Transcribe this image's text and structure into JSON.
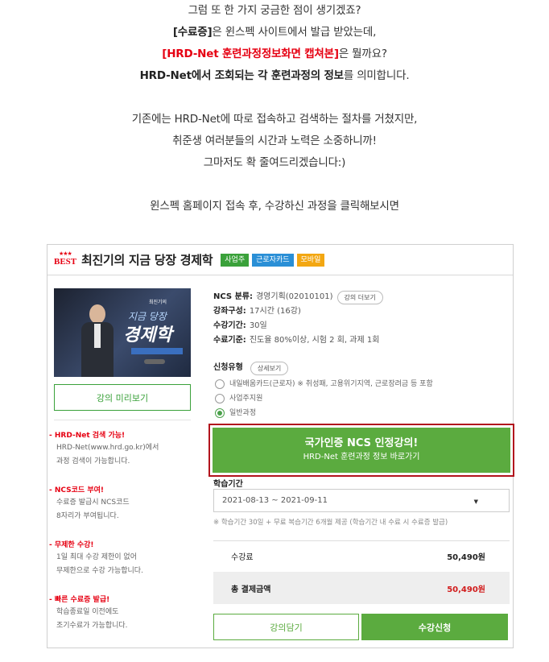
{
  "intro": {
    "line1": "그럼 또 한 가지 궁금한 점이 생기겠죠?",
    "line2_prefix": "[수료증]",
    "line2_suffix": "은 윈스펙 사이트에서 발급 받았는데,",
    "line3_highlight": "[HRD-Net 훈련과정정보화면 캡쳐본]",
    "line3_suffix": "은 뭘까요?",
    "line4_bold": "HRD-Net에서 조회되는 각 훈련과정의 정보",
    "line4_suffix": "를 의미합니다.",
    "line5": "기존에는 HRD-Net에 따로 접속하고 검색하는 절차를 거쳤지만,",
    "line6": "취준생 여러분들의 시간과 노력은 소중하니까!",
    "line7": "그마저도 확 줄여드리겠습니다:)",
    "line8": "윈스펙 홈페이지 접속 후, 수강하신 과정을 클릭해보시면"
  },
  "card": {
    "best_badge": "BEST",
    "title": "최진기의 지금 당장 경제학",
    "tags": [
      {
        "label": "사업주",
        "color": "#3aa13a"
      },
      {
        "label": "근로자카드",
        "color": "#2a8fd6"
      },
      {
        "label": "모바일",
        "color": "#f3a712"
      }
    ],
    "thumbnail": {
      "small_text": "지금 당장",
      "big_text": "경제학",
      "corner_text": "최진기의"
    },
    "preview_button": "강의 미리보기",
    "features": [
      {
        "title": "- HRD-Net 검색 가능!",
        "desc1": "HRD-Net(www.hrd.go.kr)에서",
        "desc2": "과정 검색이 가능합니다."
      },
      {
        "title": "- NCS코드 부여!",
        "desc1": "수료증 발급시 NCS코드",
        "desc2": "8자리가 부여됩니다."
      },
      {
        "title": "- 무제한 수강!",
        "desc1": "1일 최대 수강 제한이 없어",
        "desc2": "무제한으로 수강 가능합니다."
      },
      {
        "title": "- 빠른 수료증 발급!",
        "desc1": "학습종료일 이전에도",
        "desc2": "조기수료가 가능합니다."
      }
    ],
    "info": {
      "ncs_label": "NCS 분류:",
      "ncs_value": "경영기획(02010101)",
      "more_button": "강의 더보기",
      "composition_label": "강좌구성:",
      "composition_value": "17시간 (16강)",
      "period_label": "수강기간:",
      "period_value": "30일",
      "criteria_label": "수료기준:",
      "criteria_value": "진도율 80%이상, 시험 2 회, 과제 1회"
    },
    "apply_type": {
      "label": "신청유형",
      "detail_button": "상세보기",
      "options": [
        {
          "label": "내일배움카드(근로자) ※ 취성패, 고용위기지역, 근로장려금 등 포함",
          "selected": false
        },
        {
          "label": "사업주지원",
          "selected": false
        },
        {
          "label": "일반과정",
          "selected": true
        }
      ]
    },
    "cta": {
      "line1": "국가인증 NCS 인정강의!",
      "line2": "HRD-Net 훈련과정 정보 바로가기"
    },
    "study_period": {
      "label": "학습기간",
      "selected": "2021-08-13 ~ 2021-09-11",
      "note": "※ 학습기간 30일 + 무료 복습기간 6개월 제공 (학습기간 내 수료 시 수료증 발급)"
    },
    "price": {
      "fee_label": "수강료",
      "fee_value": "50,490원",
      "total_label": "총 결제금액",
      "total_value": "50,490원"
    },
    "buttons": {
      "wishlist": "강의담기",
      "apply": "수강신청"
    }
  }
}
